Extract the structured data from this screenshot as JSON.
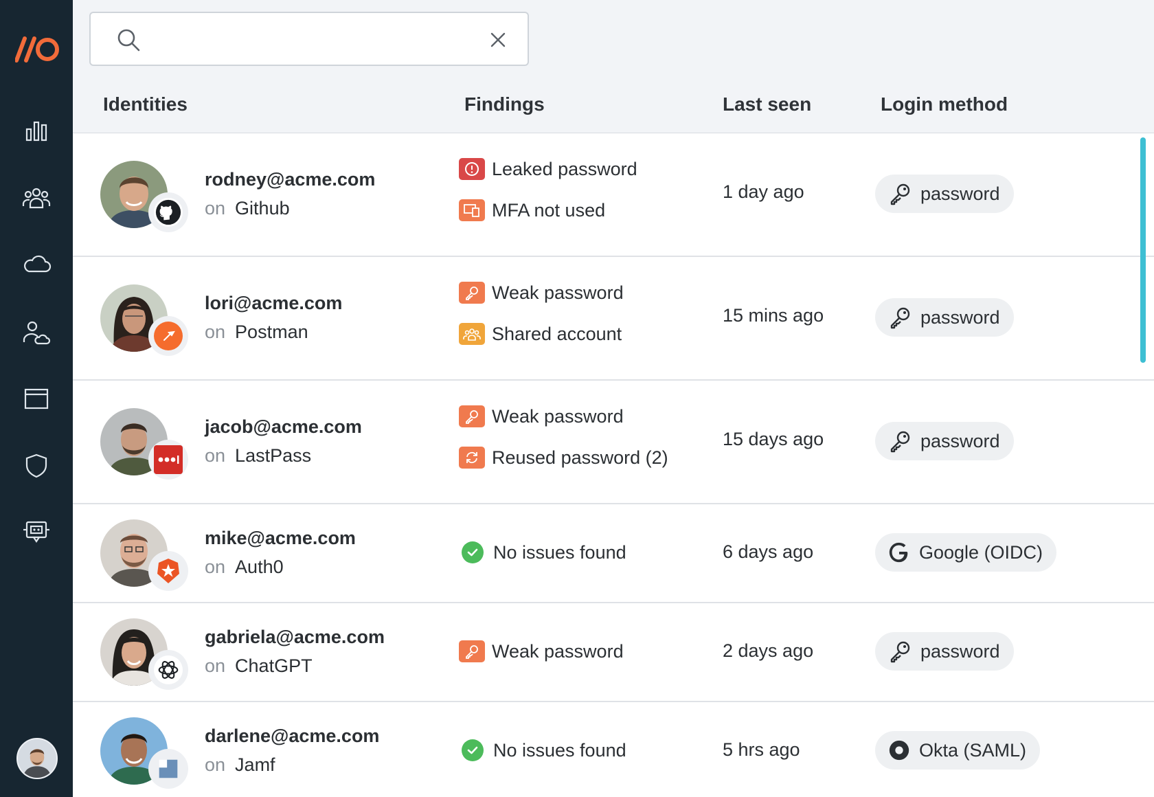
{
  "search": {
    "value": "",
    "placeholder": ""
  },
  "columns": {
    "identities": "Identities",
    "findings": "Findings",
    "last_seen": "Last seen",
    "login_method": "Login method"
  },
  "on_word": "on",
  "rows": [
    {
      "email": "rodney@acme.com",
      "app": "Github",
      "findings": [
        {
          "label": "Leaked password",
          "icon": "alert-icon",
          "color": "#d94848"
        },
        {
          "label": "MFA not used",
          "icon": "devices-icon",
          "color": "#f07a4e"
        }
      ],
      "last_seen": "1 day ago",
      "login": {
        "label": "password",
        "icon": "key-icon"
      }
    },
    {
      "email": "lori@acme.com",
      "app": "Postman",
      "findings": [
        {
          "label": "Weak password",
          "icon": "key-icon",
          "color": "#f07a4e"
        },
        {
          "label": "Shared account",
          "icon": "users-icon",
          "color": "#f0a53a"
        }
      ],
      "last_seen": "15 mins ago",
      "login": {
        "label": "password",
        "icon": "key-icon"
      }
    },
    {
      "email": "jacob@acme.com",
      "app": "LastPass",
      "findings": [
        {
          "label": "Weak password",
          "icon": "key-icon",
          "color": "#f07a4e"
        },
        {
          "label": "Reused password (2)",
          "icon": "refresh-icon",
          "color": "#f07a4e"
        }
      ],
      "last_seen": "15 days ago",
      "login": {
        "label": "password",
        "icon": "key-icon"
      }
    },
    {
      "email": "mike@acme.com",
      "app": "Auth0",
      "findings": [
        {
          "label": "No issues found",
          "icon": "check-icon",
          "color": "#4cbb5b"
        }
      ],
      "last_seen": "6 days ago",
      "login": {
        "label": "Google (OIDC)",
        "icon": "google-icon"
      }
    },
    {
      "email": "gabriela@acme.com",
      "app": "ChatGPT",
      "findings": [
        {
          "label": "Weak password",
          "icon": "key-icon",
          "color": "#f07a4e"
        }
      ],
      "last_seen": "2 days ago",
      "login": {
        "label": "password",
        "icon": "key-icon"
      }
    },
    {
      "email": "darlene@acme.com",
      "app": "Jamf",
      "findings": [
        {
          "label": "No issues found",
          "icon": "check-icon",
          "color": "#4cbb5b"
        }
      ],
      "last_seen": "5 hrs ago",
      "login": {
        "label": "Okta (SAML)",
        "icon": "okta-icon"
      }
    }
  ],
  "colors": {
    "sidebar": "#172631",
    "brand": "#f26b3a",
    "accent_scroll": "#3ebfd3"
  }
}
